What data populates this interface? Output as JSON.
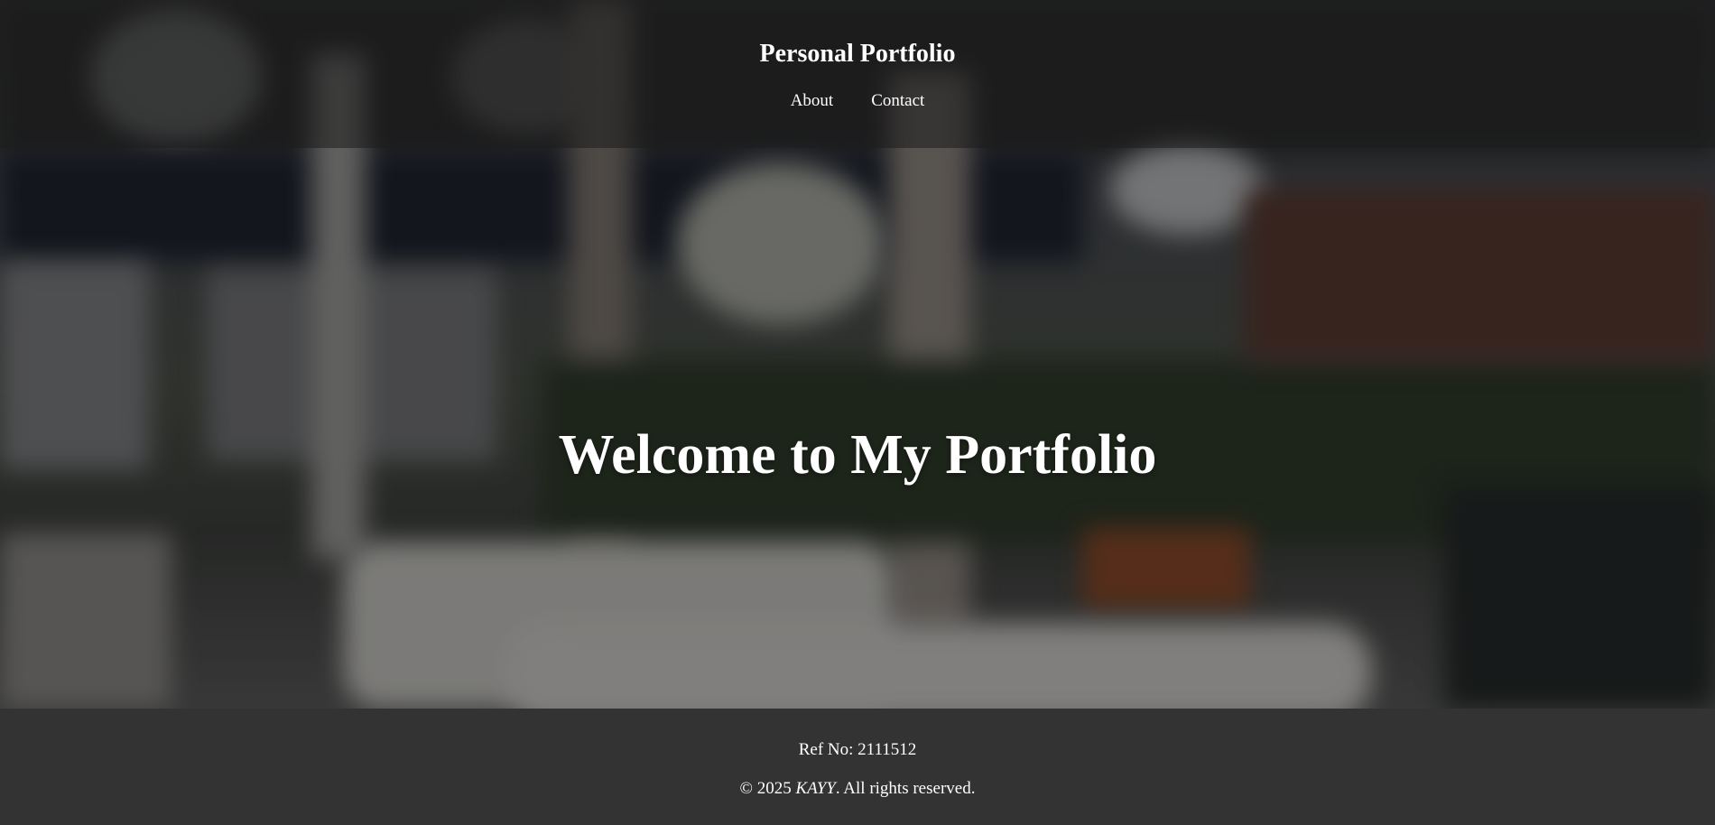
{
  "header": {
    "title": "Personal Portfolio",
    "nav": [
      {
        "label": "About"
      },
      {
        "label": "Contact"
      }
    ]
  },
  "hero": {
    "title": "Welcome to My Portfolio"
  },
  "footer": {
    "ref": "Ref No: 2111512",
    "copyright_prefix": "© 2025 ",
    "copyright_name": "KAYY",
    "copyright_suffix": ". All rights reserved."
  },
  "colors": {
    "footer_bg": "#333333",
    "text": "#ffffff"
  }
}
